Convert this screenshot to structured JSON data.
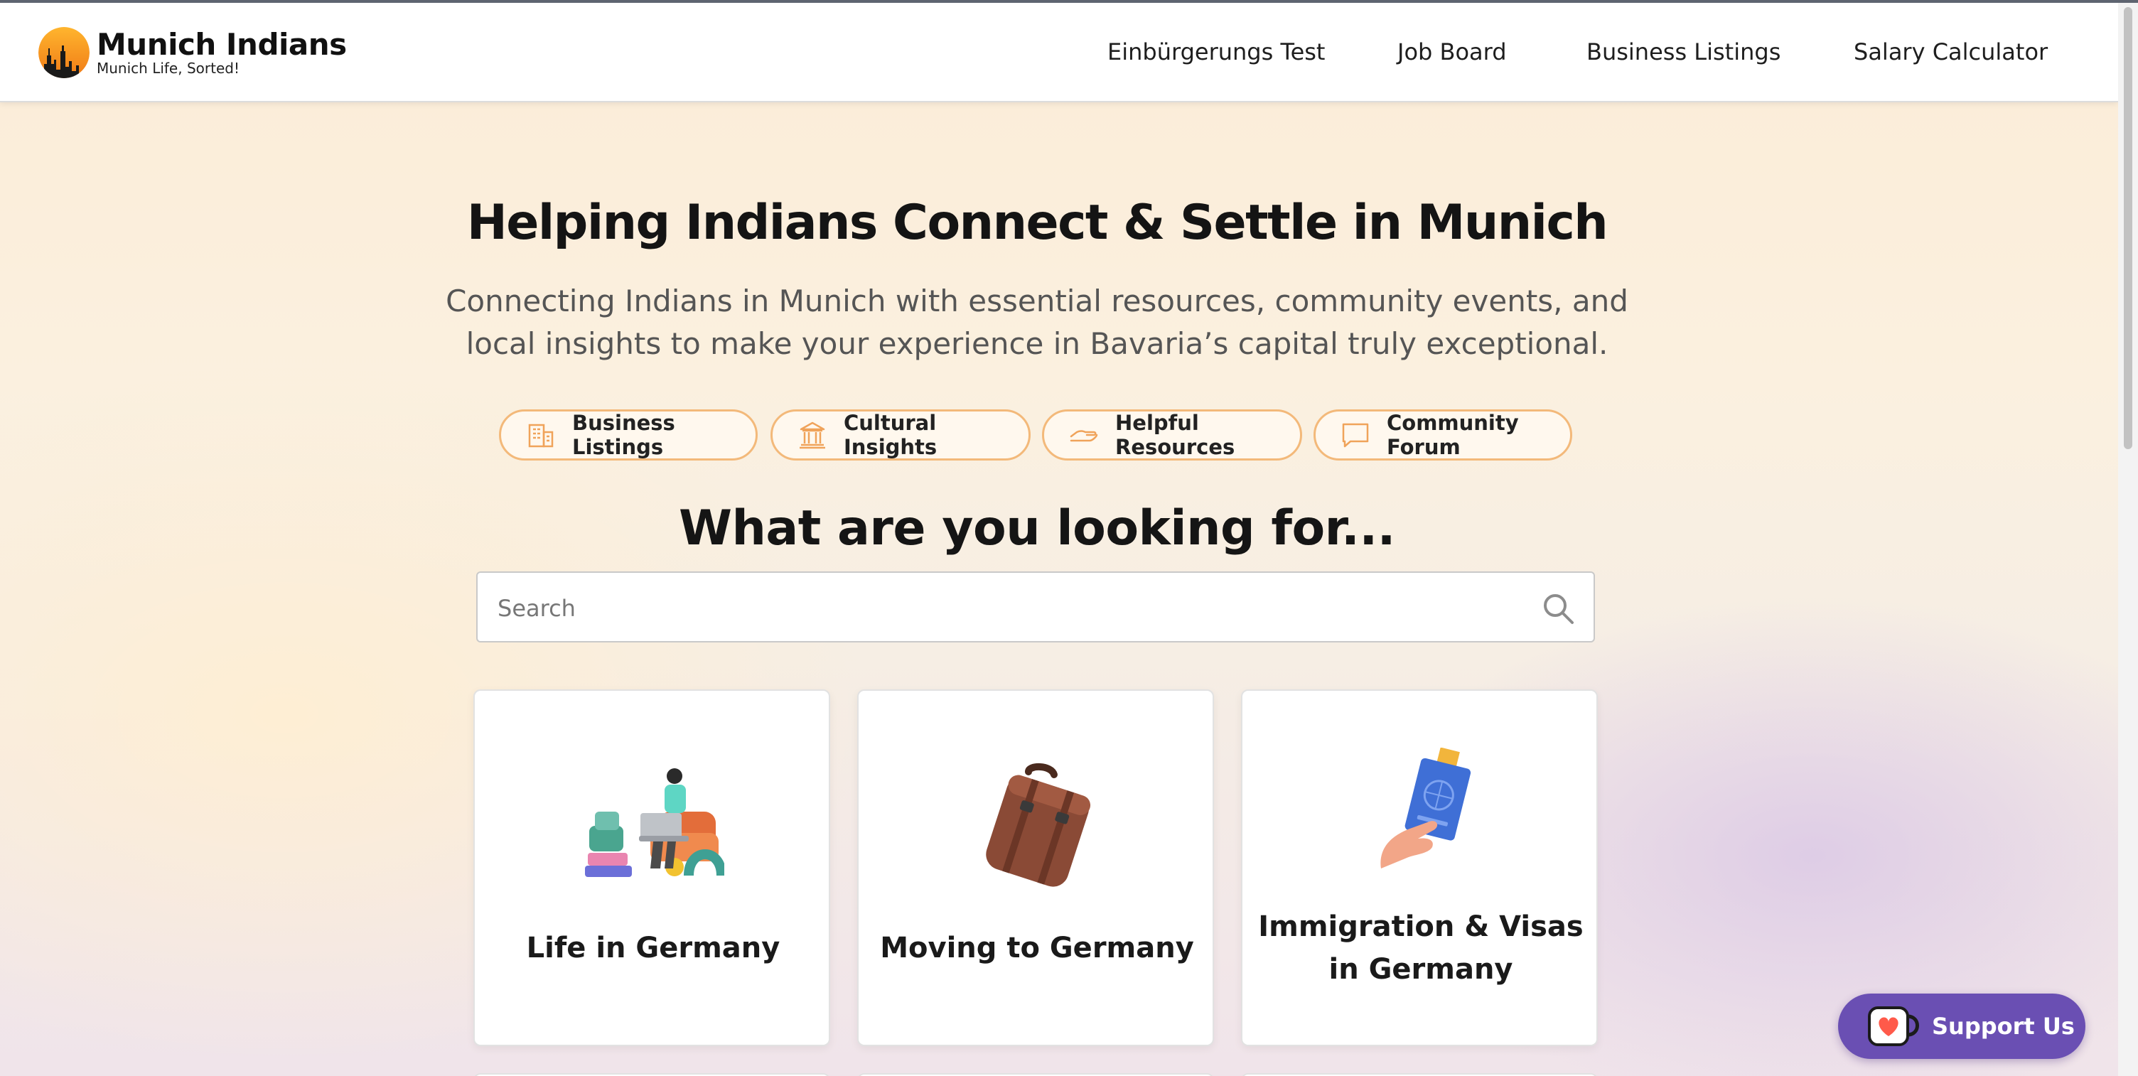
{
  "header": {
    "logo_title": "Munich Indians",
    "logo_tagline": "Munich Life, Sorted!",
    "nav": [
      "Einbürgerungs Test",
      "Job Board",
      "Business Listings",
      "Salary Calculator"
    ]
  },
  "hero": {
    "title": "Helping Indians Connect & Settle in Munich",
    "subtitle": "Connecting Indians in Munich with essential resources, community events, and local insights to make your experience in Bavaria’s capital truly exceptional."
  },
  "quick_links": [
    {
      "label": "Business Listings",
      "icon": "building-icon"
    },
    {
      "label": "Cultural Insights",
      "icon": "museum-icon"
    },
    {
      "label": "Helpful Resources",
      "icon": "helping-hand-icon"
    },
    {
      "label": "Community Forum",
      "icon": "chat-bubble-icon"
    }
  ],
  "search": {
    "heading": "What are you looking for...",
    "placeholder": "Search"
  },
  "cards": [
    {
      "label": "Life in Germany",
      "icon": "person-on-couch-illustration"
    },
    {
      "label": "Moving to Germany",
      "icon": "suitcase-illustration"
    },
    {
      "label": "Immigration & Visas in Germany",
      "icon": "passport-in-hand-illustration"
    }
  ],
  "support_button": {
    "label": "Support Us",
    "icon": "coffee-cup-heart-icon"
  },
  "colors": {
    "accent_orange": "#f3b97a",
    "support_purple": "#6a4fb3"
  }
}
